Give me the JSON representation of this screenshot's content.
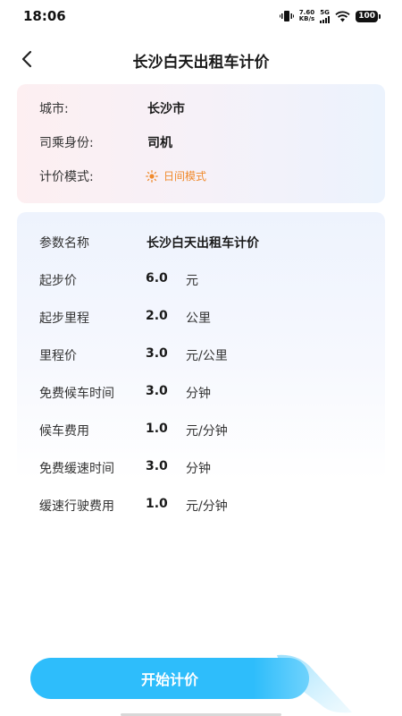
{
  "status_bar": {
    "time": "18:06",
    "net_speed_value": "7.60",
    "net_speed_unit": "KB/s",
    "network": "5G",
    "battery": "100"
  },
  "header": {
    "title": "长沙白天出租车计价"
  },
  "info": {
    "city_label": "城市:",
    "city_value": "长沙市",
    "identity_label": "司乘身份:",
    "identity_value": "司机",
    "mode_label": "计价模式:",
    "mode_value": "日间模式",
    "mode_color": "#f08a2c"
  },
  "params": {
    "name_label": "参数名称",
    "name_value": "长沙白天出租车计价",
    "rows": [
      {
        "label": "起步价",
        "value": "6.0",
        "unit": "元"
      },
      {
        "label": "起步里程",
        "value": "2.0",
        "unit": "公里"
      },
      {
        "label": "里程价",
        "value": "3.0",
        "unit": "元/公里"
      },
      {
        "label": "免费候车时间",
        "value": "3.0",
        "unit": "分钟"
      },
      {
        "label": "候车费用",
        "value": "1.0",
        "unit": "元/分钟"
      },
      {
        "label": "免费缓速时间",
        "value": "3.0",
        "unit": "分钟"
      },
      {
        "label": "缓速行驶费用",
        "value": "1.0",
        "unit": "元/分钟"
      }
    ]
  },
  "actions": {
    "start_label": "开始计价",
    "accent_color": "#2ebdfb"
  }
}
